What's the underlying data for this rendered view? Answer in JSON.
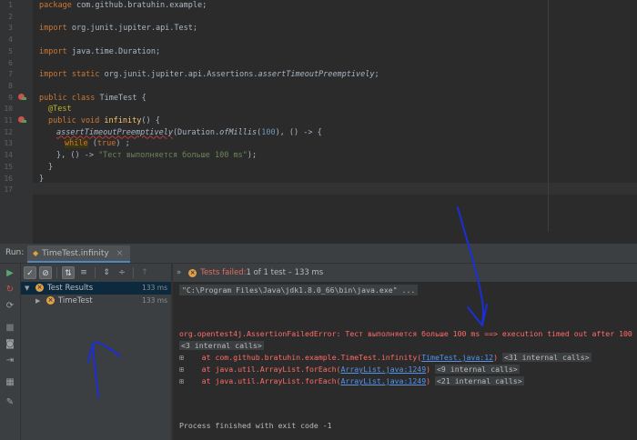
{
  "editor": {
    "line_numbers": [
      "1",
      "2",
      "3",
      "4",
      "5",
      "6",
      "7",
      "8",
      "9",
      "10",
      "11",
      "12",
      "13",
      "14",
      "15",
      "16",
      "17"
    ],
    "package_kw": "package",
    "package_name": " com.github.bratuhin.example;",
    "import1_kw": "import",
    "import1_path": " org.junit.jupiter.api.Test;",
    "import2_kw": "import",
    "import2_path": " java.time.Duration;",
    "import3_kw": "import static",
    "import3_path": " org.junit.jupiter.api.Assertions.",
    "import3_method": "assertTimeoutPreemptively",
    "import3_end": ";",
    "class_mod": "public class",
    "class_name": " TimeTest {",
    "annotation": "@Test",
    "method_mod": "public void",
    "method_name": " infinity",
    "method_end": "() {",
    "assert_call": "assertTimeoutPreemptively",
    "assert_open": "(Duration.",
    "of_millis": "ofMillis",
    "millis_paren_open": "(",
    "millis_value": "100",
    "assert_rest": "), () -> {",
    "while_kw": "while",
    "while_rest": " (",
    "while_true": "true",
    "while_end": ") ;",
    "close_lambda": "}, () -> ",
    "message": "\"Тест выполняется больше 100 ms\"",
    "close_call": ");",
    "close_method": "}",
    "close_class": "}"
  },
  "run": {
    "label": "Run:",
    "tab": "TimeTest.infinity",
    "tab_close": "×",
    "left_toolbar_icons": [
      "run-icon",
      "rerun-failed-icon",
      "toggle-auto-test-icon",
      "stop-icon",
      "camera-icon",
      "exit-icon",
      "layout-icon",
      "pin-icon"
    ],
    "test_toolbar_icons": [
      "show-passed-icon",
      "show-ignored-icon",
      "sort-alpha-icon",
      "sort-duration-icon",
      "expand-all-icon",
      "collapse-all-icon",
      "prev-failed-icon"
    ],
    "status": {
      "chevron": "»",
      "failed": "Tests failed:",
      "rest": " 1 of 1 test – 133 ms"
    },
    "tree": [
      {
        "arrow": "▼",
        "name": "Test Results",
        "duration": "133 ms"
      },
      {
        "arrow": "▶",
        "name": "TimeTest",
        "duration": "133 ms"
      }
    ],
    "console": {
      "cmd": "\"C:\\Program Files\\Java\\jdk1.8.0_66\\bin\\java.exe\" ...",
      "error": "org.opentest4j.AssertionFailedError: Тест выполняется больше 100 ms ==> execution timed out after 100 ms",
      "internal1": "<3 internal calls>",
      "at1_prefix": "    at com.github.bratuhin.example.TimeTest.infinity(",
      "at1_link": "TimeTest.java:12",
      "at1_suffix": ") ",
      "at1_fold": "<31 internal calls>",
      "at2_prefix": "    at java.util.ArrayList.forEach(",
      "at2_link": "ArrayList.java:1249",
      "at2_suffix": ") ",
      "at2_fold": "<9 internal calls>",
      "at3_prefix": "    at java.util.ArrayList.forEach(",
      "at3_link": "ArrayList.java:1249",
      "at3_suffix": ") ",
      "at3_fold": "<21 internal calls>",
      "finished": "Process finished with exit code -1"
    }
  },
  "colors": {
    "annotation_ink": "#1a2fd6",
    "error_text": "#ff6b68",
    "link": "#5394ec"
  }
}
